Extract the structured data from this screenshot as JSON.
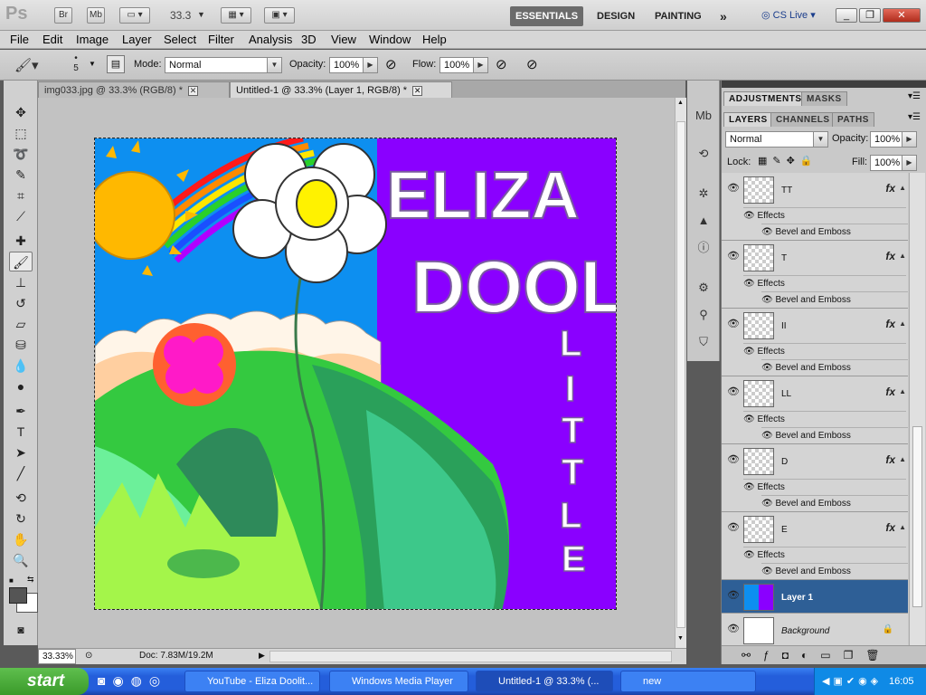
{
  "app": {
    "logo": "Ps",
    "bridge": "Br",
    "minibridge": "Mb",
    "zoom": "33.3",
    "workspaces": [
      "ESSENTIALS",
      "DESIGN",
      "PAINTING"
    ],
    "more": "»",
    "cslive": "CS Live"
  },
  "menu": [
    "File",
    "Edit",
    "Image",
    "Layer",
    "Select",
    "Filter",
    "Analysis",
    "3D",
    "View",
    "Window",
    "Help"
  ],
  "options": {
    "brush_size": "5",
    "mode_label": "Mode:",
    "mode_value": "Normal",
    "opacity_label": "Opacity:",
    "opacity_value": "100%",
    "flow_label": "Flow:",
    "flow_value": "100%"
  },
  "tabs": [
    {
      "label": "img033.jpg @ 33.3% (RGB/8) *"
    },
    {
      "label": "Untitled-1 @ 33.3% (Layer 1, RGB/8) *"
    }
  ],
  "status": {
    "zoom": "33.33%",
    "doc": "Doc: 7.83M/19.2M"
  },
  "artwork": {
    "title_line1": "ELIZA",
    "title_line2": "DOOL",
    "title_vertical": "LITTLE"
  },
  "panels": {
    "top_tabs": [
      "ADJUSTMENTS",
      "MASKS"
    ],
    "layer_tabs": [
      "LAYERS",
      "CHANNELS",
      "PATHS"
    ],
    "blend_mode": "Normal",
    "opacity_label": "Opacity:",
    "opacity_value": "100%",
    "lock_label": "Lock:",
    "fill_label": "Fill:",
    "fill_value": "100%",
    "effects_label": "Effects",
    "effect_name": "Bevel and Emboss",
    "fx_label": "fx",
    "layers": [
      {
        "name": "TT"
      },
      {
        "name": "T"
      },
      {
        "name": "II"
      },
      {
        "name": "LL"
      },
      {
        "name": "D"
      },
      {
        "name": "E"
      }
    ],
    "layer1": "Layer 1",
    "background": "Background"
  },
  "taskbar": {
    "start": "start",
    "tasks": [
      "YouTube - Eliza Doolit...",
      "Windows Media Player",
      "Untitled-1 @ 33.3% (...",
      "new"
    ],
    "clock": "16:05"
  },
  "colors": {
    "accent": "#2e5f96",
    "purple": "#8a00ff",
    "sky": "#0d8ff0"
  }
}
